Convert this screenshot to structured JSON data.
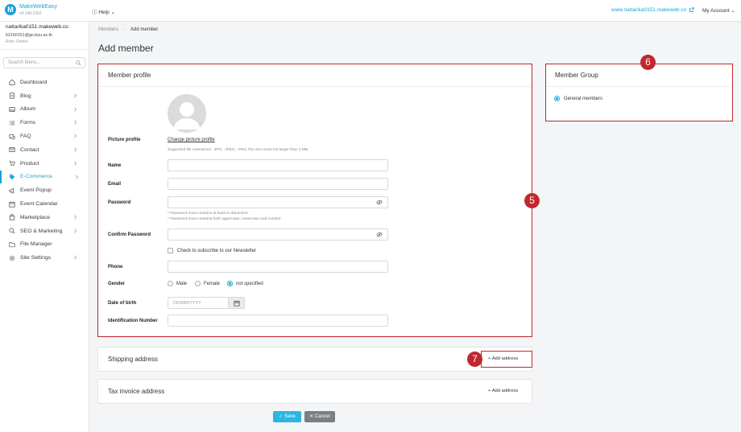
{
  "header": {
    "brand_name": "MakeWebEasy",
    "version": "v4.148.1952",
    "help_label": "Help",
    "site_url": "www.nattarika0151.makeweb.co",
    "account_label": "My Account"
  },
  "user": {
    "domain": "nattarika0151.makeweb.co",
    "email": "62160151@go.buu.ac.th",
    "role": "Role: Owner"
  },
  "sidebar": {
    "search_placeholder": "Search Menu...",
    "items": [
      {
        "label": "Dashboard",
        "icon": "home-icon",
        "has_children": false
      },
      {
        "label": "Blog",
        "icon": "document-icon",
        "has_children": true
      },
      {
        "label": "Album",
        "icon": "image-icon",
        "has_children": true
      },
      {
        "label": "Forms",
        "icon": "list-icon",
        "has_children": true
      },
      {
        "label": "FAQ",
        "icon": "chat-icon",
        "has_children": true
      },
      {
        "label": "Contact",
        "icon": "mail-icon",
        "has_children": true
      },
      {
        "label": "Product",
        "icon": "cart-icon",
        "has_children": true
      },
      {
        "label": "E-Commerce",
        "icon": "tag-icon",
        "has_children": true,
        "active": true
      },
      {
        "label": "Event Popup",
        "icon": "megaphone-icon",
        "has_children": false
      },
      {
        "label": "Event Calendar",
        "icon": "calendar-icon",
        "has_children": false
      },
      {
        "label": "Marketplace",
        "icon": "bag-icon",
        "has_children": true
      },
      {
        "label": "SEO & Marketing",
        "icon": "search-icon",
        "has_children": true
      },
      {
        "label": "File Manager",
        "icon": "folder-icon",
        "has_children": false
      },
      {
        "label": "Site Settings",
        "icon": "gear-icon",
        "has_children": true
      }
    ]
  },
  "breadcrumb": {
    "parent": "Members",
    "current": "Add member"
  },
  "page_title": "Add member",
  "profile": {
    "title": "Member profile",
    "picture_label": "Picture profile",
    "change_picture": "Change picture profile",
    "picture_hint": "Supported file extensions: .JPG, .JPEG, .PNG The size must not larger than 2 MB.",
    "name_label": "Name",
    "email_label": "Email",
    "password_label": "Password",
    "password_hint_1": "* Password must contains at least 8 characters.",
    "password_hint_2": "* Password must contains both uppercase, lowercase and number.",
    "confirm_password_label": "Confirm Password",
    "newsletter_label": "Check to subscribe to our Newsletter",
    "phone_label": "Phone",
    "gender_label": "Gender",
    "gender_options": [
      "Male",
      "Female",
      "not specified"
    ],
    "gender_selected": "not specified",
    "dob_label": "Date of birth",
    "dob_placeholder": "DD/MM/YYYY",
    "id_label": "Identification Number"
  },
  "member_group": {
    "title": "Member Group",
    "option": "General members"
  },
  "shipping": {
    "title": "Shipping address",
    "add_label": "Add address"
  },
  "tax": {
    "title": "Tax invoice address",
    "add_label": "Add address"
  },
  "actions": {
    "save": "Save",
    "cancel": "Cancel"
  },
  "annotations": {
    "badge_5": "5",
    "badge_6": "6",
    "badge_7": "7"
  },
  "colors": {
    "accent": "#1aa3d9",
    "highlight": "#c0282d"
  }
}
